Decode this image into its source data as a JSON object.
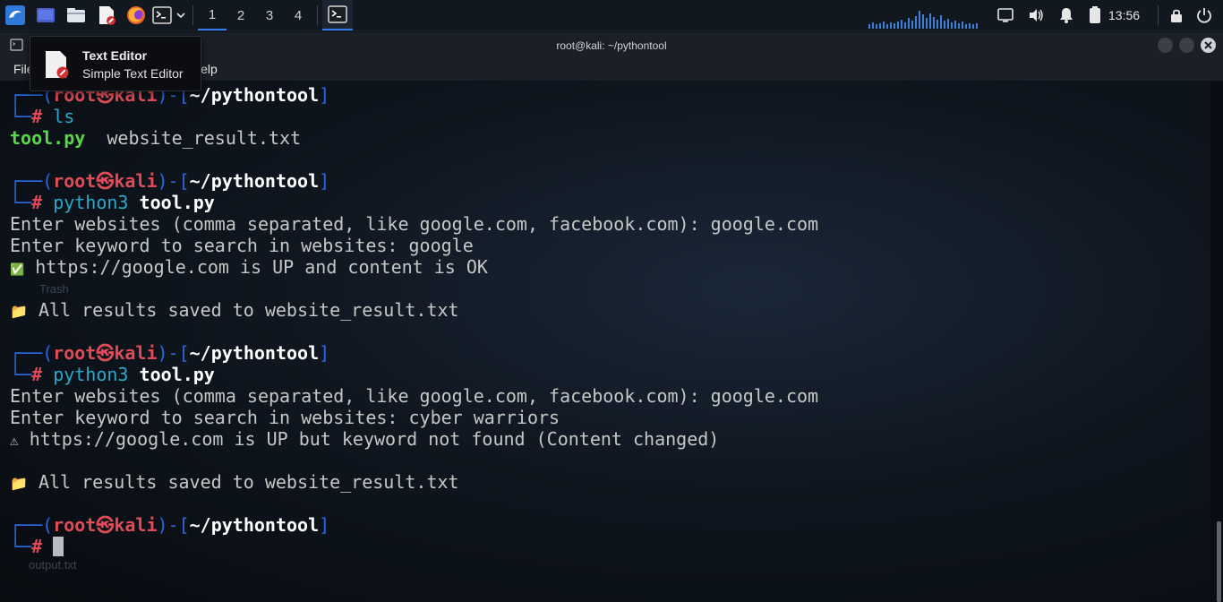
{
  "panel": {
    "workspaces": [
      "1",
      "2",
      "3",
      "4"
    ],
    "active_workspace": "1",
    "clock": "13:56",
    "icons": [
      "kali-menu-icon",
      "desktop-icon",
      "file-manager-icon",
      "text-editor-icon",
      "firefox-icon",
      "terminal-icon",
      "dropdown-chevron-icon",
      "terminal-task-icon",
      "screen-icon",
      "volume-icon",
      "notification-bell-icon",
      "battery-icon",
      "lock-icon",
      "power-icon"
    ]
  },
  "window": {
    "title": "root@kali: ~/pythontool",
    "menu": [
      "File",
      "Help"
    ]
  },
  "tooltip": {
    "title": "Text Editor",
    "subtitle": "Simple Text Editor"
  },
  "terminal": {
    "prompt": {
      "user": "root",
      "host": "kali",
      "path": "~/pythontool",
      "hash": "#",
      "skull": "㉿",
      "open": "┌──(",
      "close": ")-[",
      "end": "]",
      "corner": "└─"
    },
    "cmd1": "ls",
    "ls_py": "tool.py",
    "ls_txt": "website_result.txt",
    "cmd2_a": "python3",
    "cmd2_b": "tool.py",
    "run1": {
      "l1": "Enter websites (comma separated, like google.com, facebook.com): google.com",
      "l2": "Enter keyword to search in websites: google",
      "l3_icon": "✅",
      "l3": "https://google.com is UP and content is OK",
      "l4_icon": "📁",
      "l4": "All results saved to website_result.txt"
    },
    "run2": {
      "l1": "Enter websites (comma separated, like google.com, facebook.com): google.com",
      "l2": "Enter keyword to search in websites: cyber warriors",
      "l3_icon": "⚠",
      "l3": "https://google.com is UP but keyword not found (Content changed)",
      "l4_icon": "📁",
      "l4": "All results saved to website_result.txt"
    },
    "desktop_behind": {
      "trash": "Trash",
      "file": "output.txt"
    }
  },
  "colors": {
    "prompt_frame": "#2c66e0",
    "user_host": "#e04b57",
    "path": "#ffffff",
    "command": "#30a6c9",
    "executable": "#58d74c"
  }
}
